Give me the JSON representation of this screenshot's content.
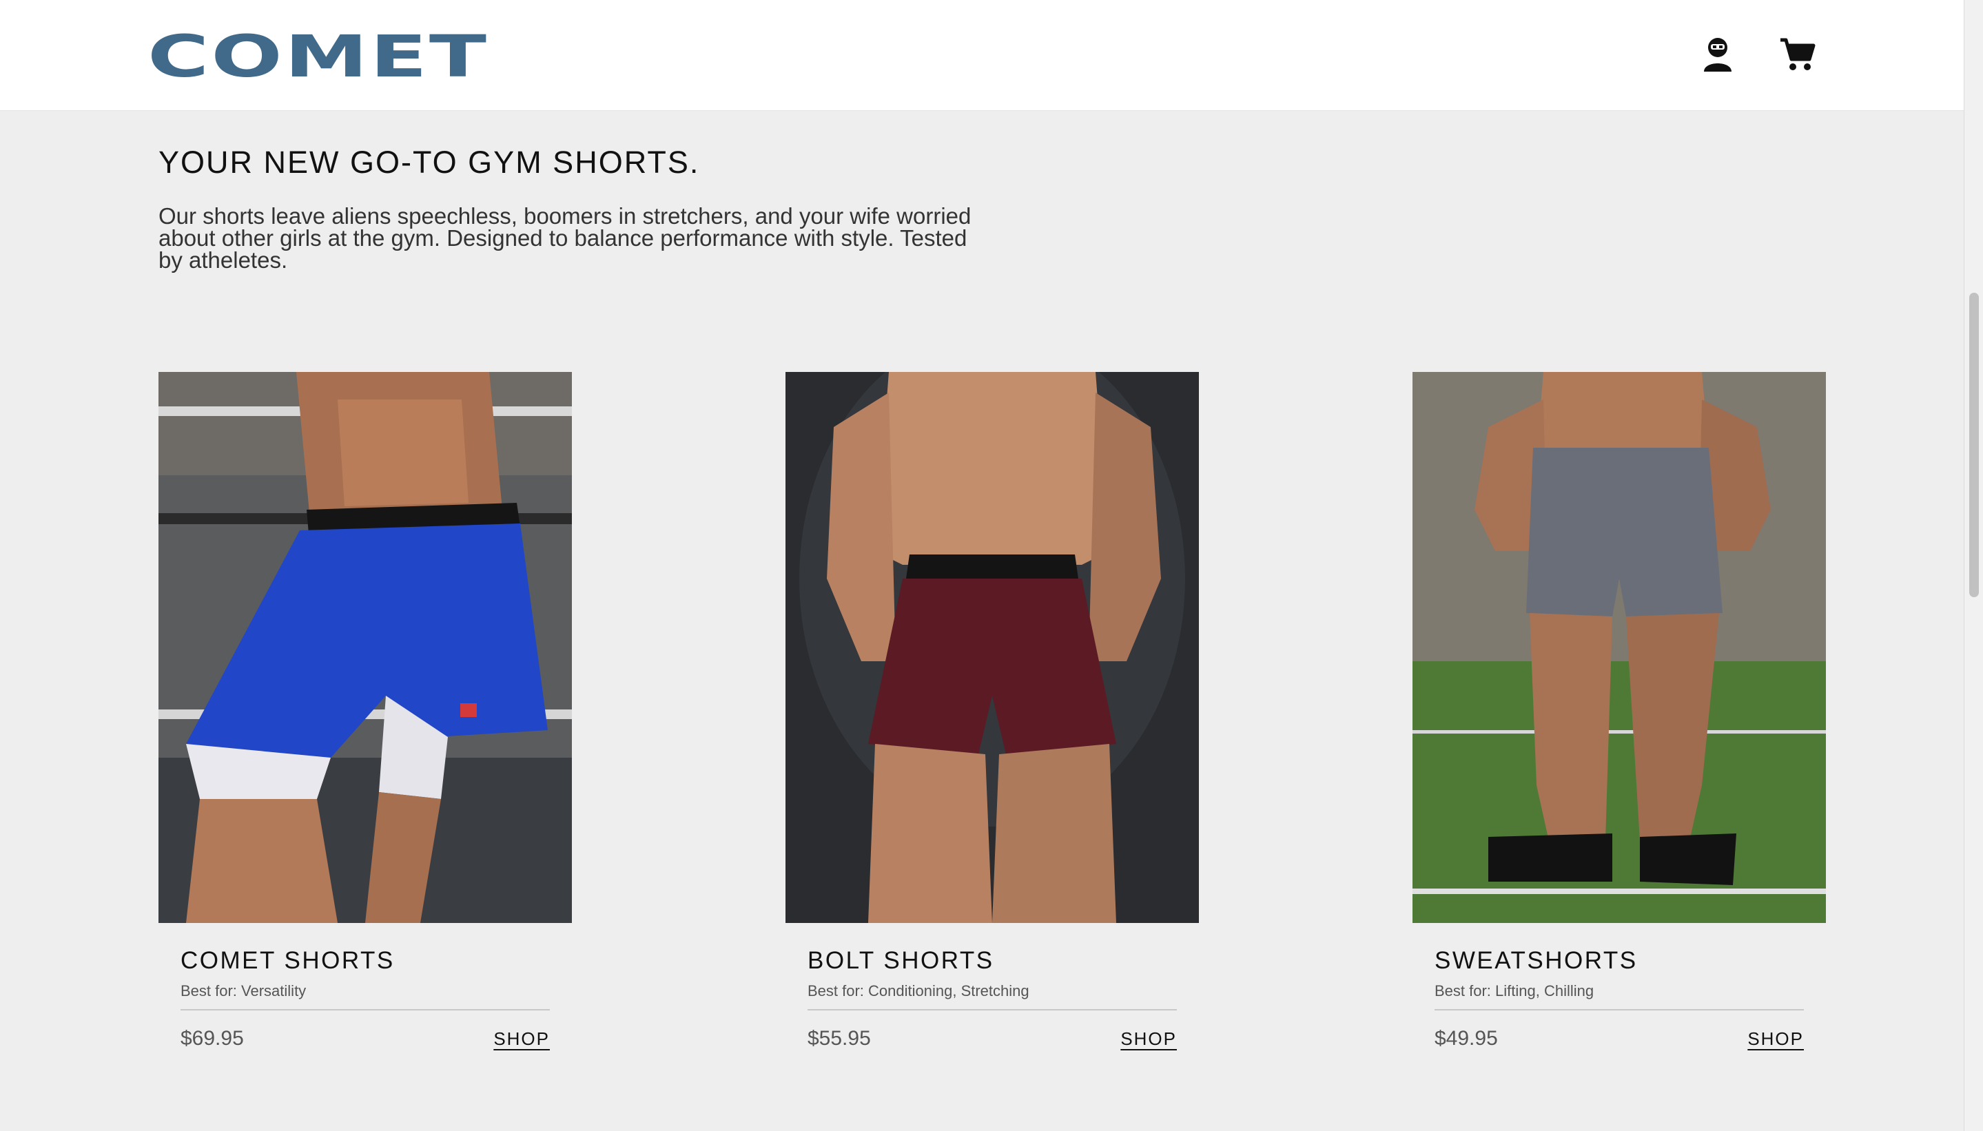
{
  "header": {
    "logo_text": "COMET",
    "account_icon": "account-icon",
    "cart_icon": "cart-icon",
    "brand_color": "#416a8a"
  },
  "intro": {
    "title": "YOUR NEW GO-TO GYM SHORTS.",
    "description": "Our shorts leave aliens speechless, boomers in stretchers, and your wife worried about other girls at the gym. Designed to balance performance with style. Tested by atheletes."
  },
  "products": [
    {
      "name": "COMET SHORTS",
      "best_for": "Best for: Versatility",
      "price": "$69.95",
      "shop_label": "SHOP",
      "shorts_color": "#2146c7"
    },
    {
      "name": "BOLT SHORTS",
      "best_for": "Best for: Conditioning, Stretching",
      "price": "$55.95",
      "shop_label": "SHOP",
      "shorts_color": "#5c1a24"
    },
    {
      "name": "SWEATSHORTS",
      "best_for": "Best for: Lifting, Chilling",
      "price": "$49.95",
      "shop_label": "SHOP",
      "shorts_color": "#6a6e78"
    }
  ]
}
